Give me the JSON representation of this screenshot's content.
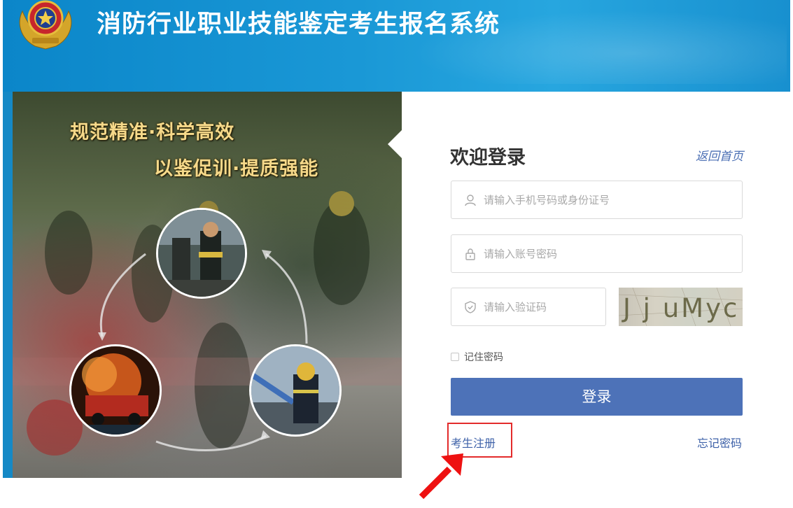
{
  "header": {
    "title": "消防行业职业技能鉴定考生报名系统",
    "emblem_icon": "fire-rescue-emblem-icon"
  },
  "banner": {
    "slogan_line1": "规范精准·科学高效",
    "slogan_line2": "以鉴促训·提质强能"
  },
  "login": {
    "title": "欢迎登录",
    "home_link": "返回首页",
    "username_placeholder": "请输入手机号码或身份证号",
    "password_placeholder": "请输入账号密码",
    "captcha_placeholder": "请输入验证码",
    "captcha_text": "J j uMyc",
    "remember_label": "记住密码",
    "submit_label": "登录",
    "register_link": "考生注册",
    "forgot_link": "忘记密码"
  },
  "colors": {
    "header_blue": "#1a98d6",
    "button_blue": "#4d72b8",
    "link_blue": "#3d61a8",
    "annotation_red": "#e32b2b",
    "slogan_gold": "#f6d98a"
  }
}
